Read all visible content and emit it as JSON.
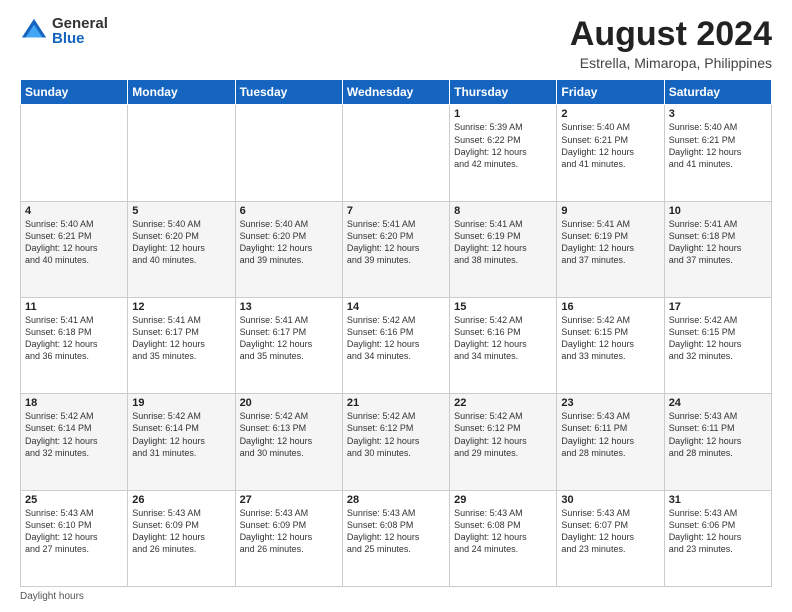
{
  "header": {
    "logo_general": "General",
    "logo_blue": "Blue",
    "month_year": "August 2024",
    "location": "Estrella, Mimaropa, Philippines"
  },
  "days_of_week": [
    "Sunday",
    "Monday",
    "Tuesday",
    "Wednesday",
    "Thursday",
    "Friday",
    "Saturday"
  ],
  "footer": {
    "daylight_label": "Daylight hours"
  },
  "weeks": [
    [
      {
        "day": "",
        "info": ""
      },
      {
        "day": "",
        "info": ""
      },
      {
        "day": "",
        "info": ""
      },
      {
        "day": "",
        "info": ""
      },
      {
        "day": "1",
        "info": "Sunrise: 5:39 AM\nSunset: 6:22 PM\nDaylight: 12 hours\nand 42 minutes."
      },
      {
        "day": "2",
        "info": "Sunrise: 5:40 AM\nSunset: 6:21 PM\nDaylight: 12 hours\nand 41 minutes."
      },
      {
        "day": "3",
        "info": "Sunrise: 5:40 AM\nSunset: 6:21 PM\nDaylight: 12 hours\nand 41 minutes."
      }
    ],
    [
      {
        "day": "4",
        "info": "Sunrise: 5:40 AM\nSunset: 6:21 PM\nDaylight: 12 hours\nand 40 minutes."
      },
      {
        "day": "5",
        "info": "Sunrise: 5:40 AM\nSunset: 6:20 PM\nDaylight: 12 hours\nand 40 minutes."
      },
      {
        "day": "6",
        "info": "Sunrise: 5:40 AM\nSunset: 6:20 PM\nDaylight: 12 hours\nand 39 minutes."
      },
      {
        "day": "7",
        "info": "Sunrise: 5:41 AM\nSunset: 6:20 PM\nDaylight: 12 hours\nand 39 minutes."
      },
      {
        "day": "8",
        "info": "Sunrise: 5:41 AM\nSunset: 6:19 PM\nDaylight: 12 hours\nand 38 minutes."
      },
      {
        "day": "9",
        "info": "Sunrise: 5:41 AM\nSunset: 6:19 PM\nDaylight: 12 hours\nand 37 minutes."
      },
      {
        "day": "10",
        "info": "Sunrise: 5:41 AM\nSunset: 6:18 PM\nDaylight: 12 hours\nand 37 minutes."
      }
    ],
    [
      {
        "day": "11",
        "info": "Sunrise: 5:41 AM\nSunset: 6:18 PM\nDaylight: 12 hours\nand 36 minutes."
      },
      {
        "day": "12",
        "info": "Sunrise: 5:41 AM\nSunset: 6:17 PM\nDaylight: 12 hours\nand 35 minutes."
      },
      {
        "day": "13",
        "info": "Sunrise: 5:41 AM\nSunset: 6:17 PM\nDaylight: 12 hours\nand 35 minutes."
      },
      {
        "day": "14",
        "info": "Sunrise: 5:42 AM\nSunset: 6:16 PM\nDaylight: 12 hours\nand 34 minutes."
      },
      {
        "day": "15",
        "info": "Sunrise: 5:42 AM\nSunset: 6:16 PM\nDaylight: 12 hours\nand 34 minutes."
      },
      {
        "day": "16",
        "info": "Sunrise: 5:42 AM\nSunset: 6:15 PM\nDaylight: 12 hours\nand 33 minutes."
      },
      {
        "day": "17",
        "info": "Sunrise: 5:42 AM\nSunset: 6:15 PM\nDaylight: 12 hours\nand 32 minutes."
      }
    ],
    [
      {
        "day": "18",
        "info": "Sunrise: 5:42 AM\nSunset: 6:14 PM\nDaylight: 12 hours\nand 32 minutes."
      },
      {
        "day": "19",
        "info": "Sunrise: 5:42 AM\nSunset: 6:14 PM\nDaylight: 12 hours\nand 31 minutes."
      },
      {
        "day": "20",
        "info": "Sunrise: 5:42 AM\nSunset: 6:13 PM\nDaylight: 12 hours\nand 30 minutes."
      },
      {
        "day": "21",
        "info": "Sunrise: 5:42 AM\nSunset: 6:12 PM\nDaylight: 12 hours\nand 30 minutes."
      },
      {
        "day": "22",
        "info": "Sunrise: 5:42 AM\nSunset: 6:12 PM\nDaylight: 12 hours\nand 29 minutes."
      },
      {
        "day": "23",
        "info": "Sunrise: 5:43 AM\nSunset: 6:11 PM\nDaylight: 12 hours\nand 28 minutes."
      },
      {
        "day": "24",
        "info": "Sunrise: 5:43 AM\nSunset: 6:11 PM\nDaylight: 12 hours\nand 28 minutes."
      }
    ],
    [
      {
        "day": "25",
        "info": "Sunrise: 5:43 AM\nSunset: 6:10 PM\nDaylight: 12 hours\nand 27 minutes."
      },
      {
        "day": "26",
        "info": "Sunrise: 5:43 AM\nSunset: 6:09 PM\nDaylight: 12 hours\nand 26 minutes."
      },
      {
        "day": "27",
        "info": "Sunrise: 5:43 AM\nSunset: 6:09 PM\nDaylight: 12 hours\nand 26 minutes."
      },
      {
        "day": "28",
        "info": "Sunrise: 5:43 AM\nSunset: 6:08 PM\nDaylight: 12 hours\nand 25 minutes."
      },
      {
        "day": "29",
        "info": "Sunrise: 5:43 AM\nSunset: 6:08 PM\nDaylight: 12 hours\nand 24 minutes."
      },
      {
        "day": "30",
        "info": "Sunrise: 5:43 AM\nSunset: 6:07 PM\nDaylight: 12 hours\nand 23 minutes."
      },
      {
        "day": "31",
        "info": "Sunrise: 5:43 AM\nSunset: 6:06 PM\nDaylight: 12 hours\nand 23 minutes."
      }
    ]
  ]
}
